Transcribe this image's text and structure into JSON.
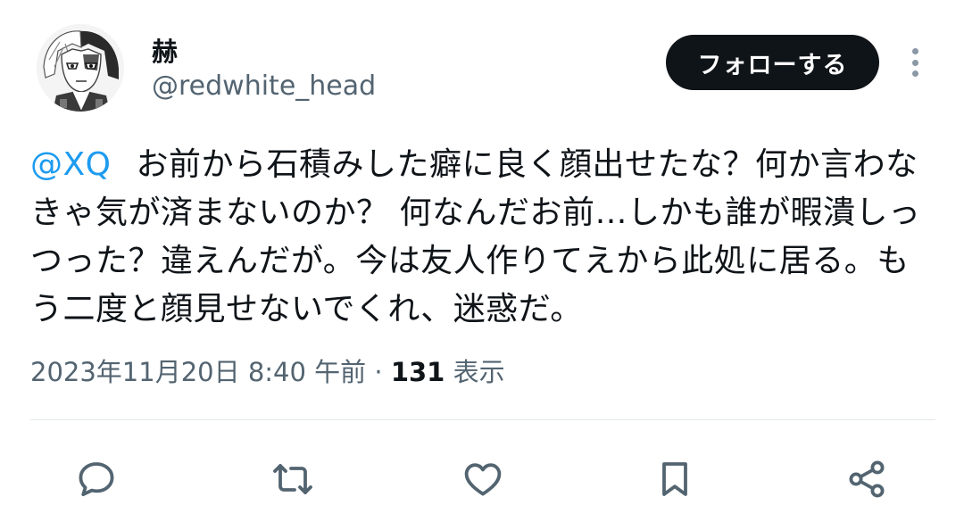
{
  "user": {
    "display_name": "赫",
    "handle": "@redwhite_head",
    "avatar_icon": "anime-character-avatar"
  },
  "follow_button": {
    "label": "フォローする"
  },
  "more_button": {
    "icon": "more-vertical-icon"
  },
  "tweet": {
    "mention": "@XQ",
    "text": "お前から石積みした癖に良く顔出せたな？何か言わなきゃ気が済まないのか？ 何なんだお前…しかも誰が暇潰しっつった？違えんだが。今は友人作りてえから此処に居る。もう二度と顔見せないでくれ、迷惑だ。"
  },
  "meta": {
    "timestamp": "2023年11月20日 8:40 午前",
    "separator": " · ",
    "views_count": "131",
    "views_label": " 表示"
  },
  "actions": [
    {
      "icon": "reply-icon"
    },
    {
      "icon": "retweet-icon"
    },
    {
      "icon": "like-icon"
    },
    {
      "icon": "bookmark-icon"
    },
    {
      "icon": "share-icon"
    }
  ],
  "colors": {
    "text_primary": "#0f1419",
    "text_secondary": "#536471",
    "link": "#1d9bf0",
    "button_bg": "#0f1419",
    "divider": "#e4e8eb"
  }
}
